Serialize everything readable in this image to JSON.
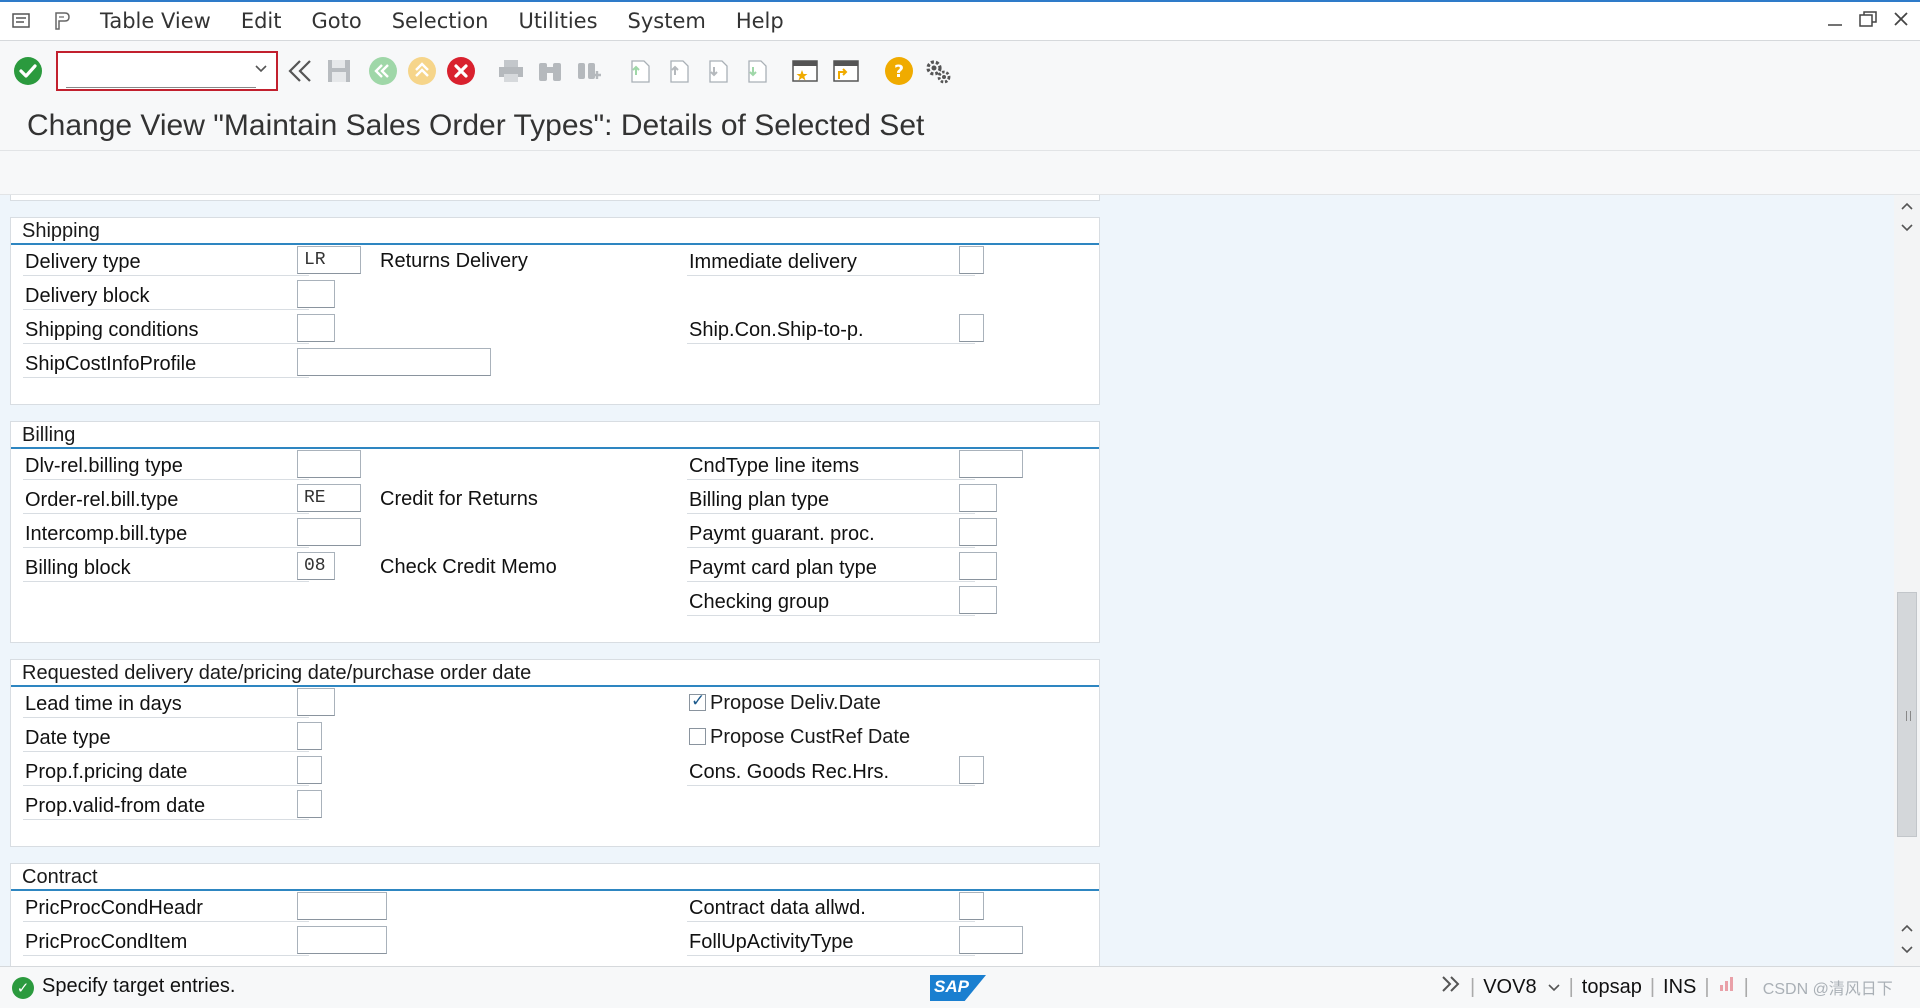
{
  "menubar": {
    "items": [
      "Table View",
      "Edit",
      "Goto",
      "Selection",
      "Utilities",
      "System",
      "Help"
    ]
  },
  "toolbar": {
    "command_value": ""
  },
  "title": "Change View \"Maintain Sales Order Types\": Details of Selected Set",
  "groups": {
    "shipping": {
      "title": "Shipping",
      "delivery_type": {
        "label": "Delivery type",
        "value": "LR",
        "desc": "Returns Delivery"
      },
      "delivery_block": {
        "label": "Delivery block",
        "value": ""
      },
      "shipping_conditions": {
        "label": "Shipping conditions",
        "value": ""
      },
      "ship_cost_info_profile": {
        "label": "ShipCostInfoProfile",
        "value": ""
      },
      "immediate_delivery": {
        "label": "Immediate delivery",
        "value": ""
      },
      "ship_con_ship_to": {
        "label": "Ship.Con.Ship-to-p.",
        "value": ""
      }
    },
    "billing": {
      "title": "Billing",
      "dlv_rel_billing_type": {
        "label": "Dlv-rel.billing type",
        "value": ""
      },
      "order_rel_bill_type": {
        "label": "Order-rel.bill.type",
        "value": "RE",
        "desc": "Credit for Returns"
      },
      "intercomp_bill_type": {
        "label": "Intercomp.bill.type",
        "value": ""
      },
      "billing_block": {
        "label": "Billing block",
        "value": "08",
        "desc": "Check Credit Memo"
      },
      "cndtype_line_items": {
        "label": "CndType line items",
        "value": ""
      },
      "billing_plan_type": {
        "label": "Billing plan type",
        "value": ""
      },
      "paymt_guarant_proc": {
        "label": "Paymt guarant. proc.",
        "value": ""
      },
      "paymt_card_plan_type": {
        "label": "Paymt card plan type",
        "value": ""
      },
      "checking_group": {
        "label": "Checking group",
        "value": ""
      }
    },
    "dates": {
      "title": "Requested delivery date/pricing date/purchase order date",
      "lead_time": {
        "label": "Lead time in days",
        "value": ""
      },
      "date_type": {
        "label": "Date type",
        "value": ""
      },
      "prop_pricing_date": {
        "label": "Prop.f.pricing date",
        "value": ""
      },
      "prop_valid_from": {
        "label": "Prop.valid-from date",
        "value": ""
      },
      "propose_deliv_date": {
        "label": "Propose Deliv.Date",
        "checked": true
      },
      "propose_custref_date": {
        "label": "Propose CustRef Date",
        "checked": false
      },
      "cons_goods_rec_hrs": {
        "label": "Cons. Goods Rec.Hrs.",
        "value": ""
      }
    },
    "contract": {
      "title": "Contract",
      "pricproc_cond_headr": {
        "label": "PricProcCondHeadr",
        "value": ""
      },
      "pricproc_cond_item": {
        "label": "PricProcCondItem",
        "value": ""
      },
      "contract_data_allwd": {
        "label": "Contract data allwd.",
        "value": ""
      },
      "follup_activity_type": {
        "label": "FollUpActivityType",
        "value": ""
      }
    }
  },
  "statusbar": {
    "message": "Specify target entries.",
    "logo": "SAP",
    "transaction": "VOV8",
    "user": "topsap",
    "mode": "INS",
    "watermark": "CSDN @清风日下"
  },
  "colors": {
    "accent": "#2e86c1",
    "ok_green": "#2b9a3e",
    "cancel_red": "#d9212e",
    "help_orange": "#f0ab00",
    "command_border": "#c2202e"
  }
}
